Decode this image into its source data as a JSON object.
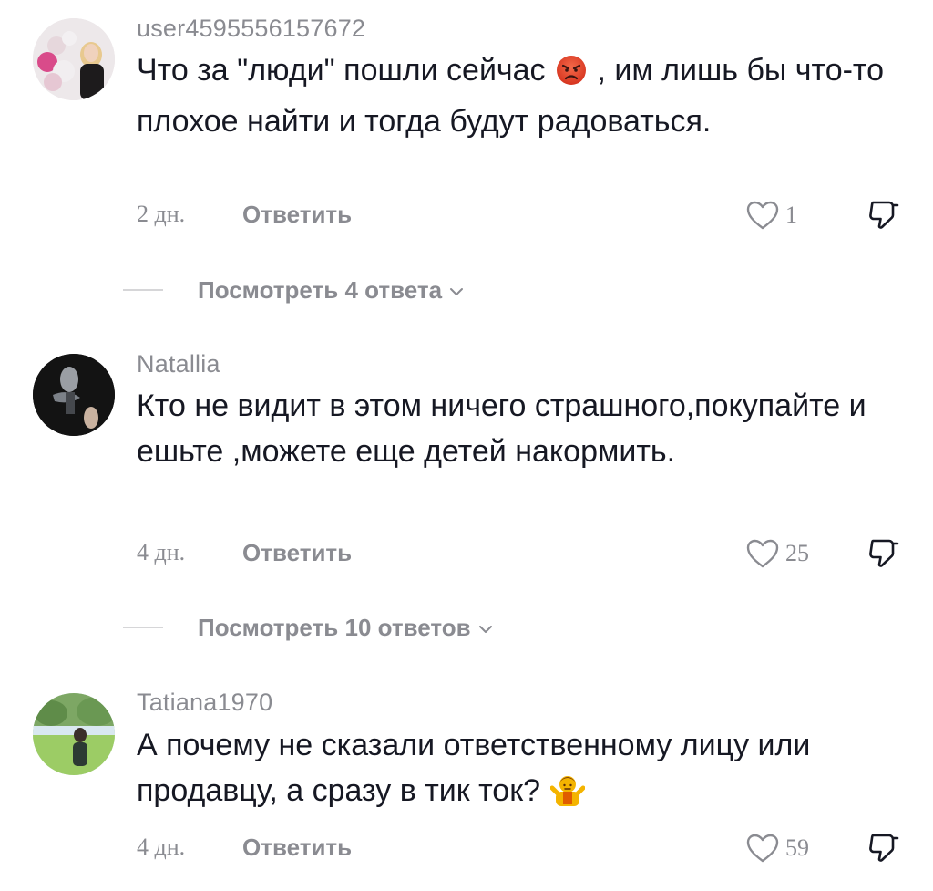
{
  "comments": [
    {
      "username": "user4595556157672",
      "text_parts": [
        "Что за \"люди\" пошли сейчас",
        ", им лишь бы что-то плохое найти и тогда будут радоваться."
      ],
      "emoji": "angry-face-icon",
      "time": "2 дн.",
      "reply_label": "Ответить",
      "likes": "1",
      "view_replies": "Посмотреть 4 ответа"
    },
    {
      "username": "Natallia",
      "text": "Кто не видит в этом ничего страшного,покупайте и ешьте ,можете еще детей накормить.",
      "time": "4 дн.",
      "reply_label": "Ответить",
      "likes": "25",
      "view_replies": "Посмотреть 10 ответов"
    },
    {
      "username": "Tatiana1970",
      "text": "А почему не сказали ответственному лицу или продавцу, а сразу в тик ток?",
      "emoji": "person-shrugging-icon",
      "time": "4 дн.",
      "reply_label": "Ответить",
      "likes": "59"
    }
  ],
  "icons": {
    "like": "heart-outline-icon",
    "dislike": "thumbs-down-icon",
    "expand": "chevron-down-icon"
  },
  "colors": {
    "text": "#161823",
    "secondary": "#8a8b91",
    "divider": "#d6d6d8",
    "angry_emoji": "#e8452c",
    "shrug_emoji": "#f4b400"
  }
}
